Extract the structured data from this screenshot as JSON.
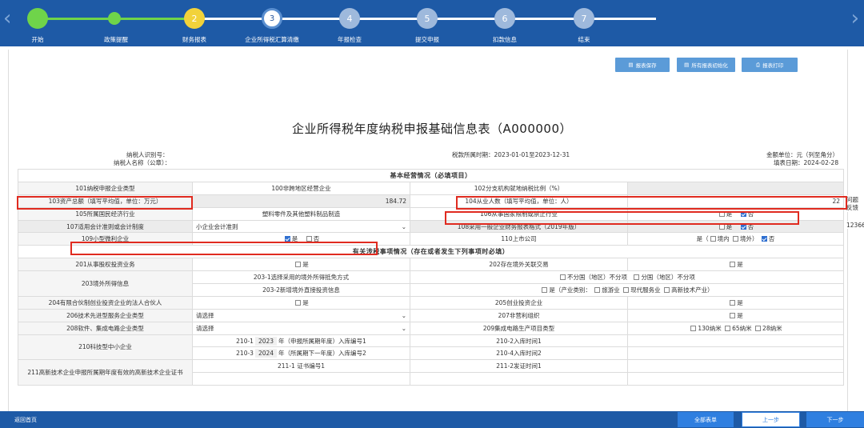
{
  "nav": {
    "steps": [
      {
        "num": "",
        "label": "开始"
      },
      {
        "num": "",
        "label": "政策提醒"
      },
      {
        "num": "2",
        "label": "财务报表"
      },
      {
        "num": "3",
        "label": "企业所得税汇算清缴"
      },
      {
        "num": "4",
        "label": "年报检查"
      },
      {
        "num": "5",
        "label": "提交申报"
      },
      {
        "num": "6",
        "label": "扣款信息"
      },
      {
        "num": "7",
        "label": "结束"
      }
    ]
  },
  "toolbar": {
    "save": "报表保存",
    "init": "所有报表初始化",
    "print": "报表打印"
  },
  "title": "企业所得税年度纳税申报基础信息表（A000000）",
  "meta": {
    "taxpayer_id": "纳税人识别号：",
    "taxpayer_name": "纳税人名称（公章）：",
    "period": "税款所属时期：2023-01-01至2023-12-31",
    "unit": "金额单位：元（列至角分）",
    "fill_date": "填表日期：2024-02-28"
  },
  "side": {
    "a": "问题",
    "b": "反馈",
    "c": "12366"
  },
  "sections": {
    "basic": "基本经营情况（必填项目）",
    "related": "有关涉税事项情况（存在或者发生下列事项时必填）"
  },
  "rows": {
    "r101": "101纳税申报企业类型",
    "r101v": "100非跨地区经营企业",
    "r102": "102分支机构就地纳税比例（%）",
    "r103": "103资产总额（填写平均值，单位：万元）",
    "r103v": "184.72",
    "r104": "104从业人数（填写平均值，单位：人）",
    "r104v": "22",
    "r105": "105所属国民经济行业",
    "r105v": "塑料零件及其他塑料制品制造",
    "r106": "106从事国家限制或禁止行业",
    "r107": "107适用会计准则或会计制度",
    "r107v": "小企业会计准则",
    "r108": "108采用一般企业财务报表格式（2019年版）",
    "r109": "109小型微利企业",
    "r110": "110上市公司",
    "r201": "201从事股权投资业务",
    "r202": "202存在境外关联交易",
    "r203": "203境外所得信息",
    "r203_1": "203-1选择采用的境外所得抵免方式",
    "r203_1v1": "不分国（地区）不分项",
    "r203_1v2": "分国（地区）不分项",
    "r203_2": "203-2新增境外直接投资信息",
    "r203_2v1": "是（产业类别：",
    "r203_2v2": "旅游业",
    "r203_2v3": "现代服务业",
    "r203_2v4": "高新技术产业）",
    "r204": "204有限合伙制创业投资企业的法人合伙人",
    "r205": "205创业投资企业",
    "r206": "206技术先进型服务企业类型",
    "r206v": "请选择",
    "r207": "207非营利组织",
    "r208": "208软件、集成电路企业类型",
    "r208v": "请选择",
    "r209": "209集成电路生产项目类型",
    "r209o1": "130纳米",
    "r209o2": "65纳米",
    "r209o3": "28纳米",
    "r210": "210科技型中小企业",
    "r210_1": "210-1",
    "r210_1y": "2023",
    "r210_1t": "年（申报所属期年度）入库编号1",
    "r210_2": "210-2入库时间1",
    "r210_3": "210-3",
    "r210_3y": "2024",
    "r210_3t": "年（所属期下一年度）入库编号2",
    "r210_4": "210-4入库时间2",
    "r211": "211高新技术企业申报所属期年度有效的高新技术企业证书",
    "r211_1": "211-1 证书编号1",
    "r211_2": "211-2发证时间1"
  },
  "labels": {
    "yes": "是",
    "no": "否",
    "domestic": "境内",
    "overseas": "境外",
    "colon": "是（",
    "paren": "）"
  },
  "bottom": {
    "home": "返回首页",
    "all": "全部表单",
    "prev": "上一步",
    "next": "下一步"
  }
}
